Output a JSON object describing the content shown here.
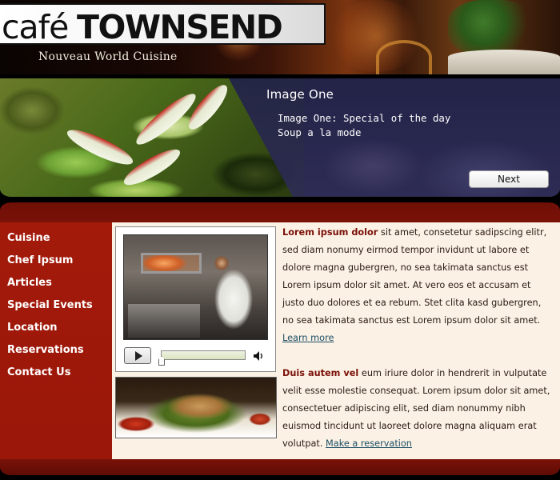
{
  "header": {
    "logo_cafe": "café",
    "logo_name": "TOWNSEND",
    "tagline": "Nouveau World Cuisine"
  },
  "slideshow": {
    "title": "Image One",
    "description_line1": "Image One: Special of the day",
    "description_line2": "Soup a la mode",
    "next_label": "Next"
  },
  "sidebar": {
    "items": [
      {
        "label": "Cuisine"
      },
      {
        "label": "Chef Ipsum"
      },
      {
        "label": "Articles"
      },
      {
        "label": "Special Events"
      },
      {
        "label": "Location"
      },
      {
        "label": "Reservations"
      },
      {
        "label": "Contact Us"
      }
    ]
  },
  "video": {
    "play_icon": "play-icon",
    "volume_icon": "speaker-icon",
    "progress": 0
  },
  "content": {
    "paragraph1": {
      "lead": "Lorem ipsum dolor",
      "text": " sit amet, consetetur sadipscing elitr, sed diam nonumy eirmod tempor invidunt ut labore et dolore magna gubergren, no sea takimata sanctus est Lorem ipsum dolor sit amet. At vero eos et accusam et justo duo dolores et ea rebum. Stet clita kasd gubergren, no sea takimata sanctus est Lorem ipsum dolor sit amet. ",
      "link": "Learn more"
    },
    "paragraph2": {
      "lead": "Duis autem vel",
      "text": " eum iriure dolor in hendrerit in vulputate velit esse molestie consequat. Lorem ipsum dolor sit amet, consectetuer adipiscing elit, sed diam nonummy nibh euismod tincidunt ut laoreet dolore magna aliquam erat volutpat. ",
      "link": "Make a reservation"
    }
  },
  "colors": {
    "brand_red": "#a31a0a",
    "dark_red": "#6e0f06",
    "cream": "#fbf1e4",
    "lead_text": "#7a1008",
    "link": "#1c4f66"
  }
}
